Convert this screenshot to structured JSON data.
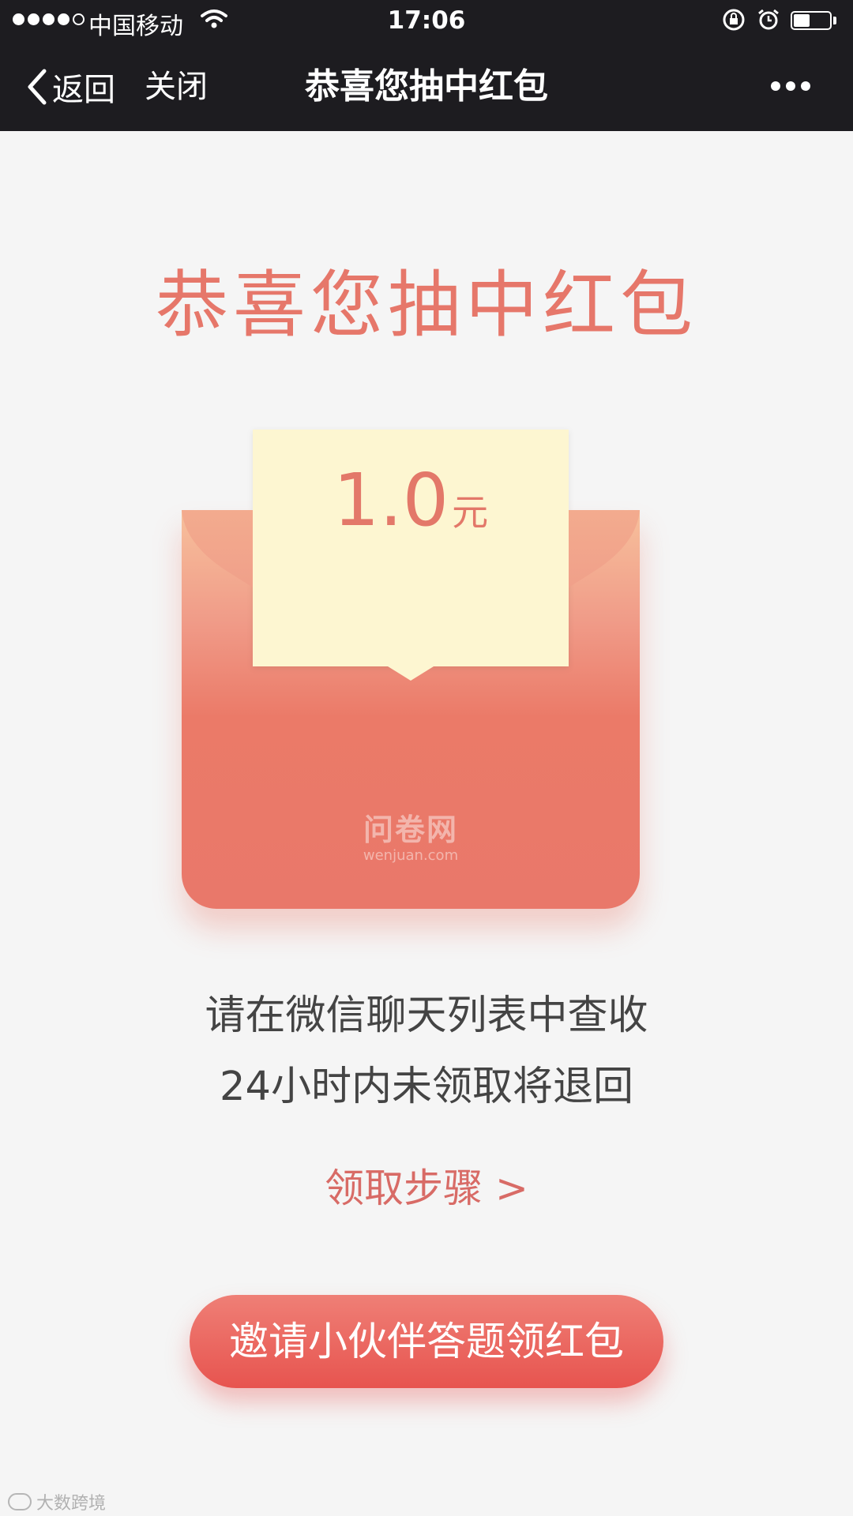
{
  "status_bar": {
    "carrier": "中国移动",
    "time": "17:06",
    "battery_level": 0.45,
    "signal_bars_filled": 4,
    "signal_bars_total": 5
  },
  "nav": {
    "back_label": "返回",
    "close_label": "关闭",
    "title": "恭喜您抽中红包"
  },
  "main": {
    "heading": "恭喜您抽中红包",
    "amount": "1.0",
    "amount_unit": "元",
    "brand_cn": "问卷网",
    "brand_en": "wenjuan.com",
    "notice_line1": "请在微信聊天列表中查收",
    "notice_line2": "24小时内未领取将退回",
    "steps_link": "领取步骤 >",
    "invite_button": "邀请小伙伴答题领红包"
  },
  "watermark": {
    "text": "大数跨境"
  },
  "colors": {
    "accent": "#e6776a",
    "button": "#e7544f",
    "nav_bg": "#1d1c20",
    "page_bg": "#f5f5f5"
  }
}
